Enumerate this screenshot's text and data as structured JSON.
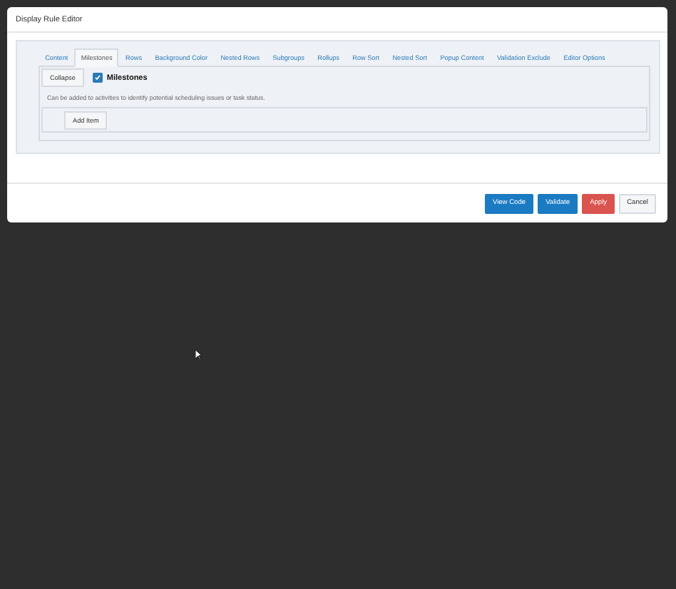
{
  "dialog": {
    "title": "Display Rule Editor"
  },
  "tabs": [
    {
      "label": "Content",
      "selected": false
    },
    {
      "label": "Milestones",
      "selected": true
    },
    {
      "label": "Rows",
      "selected": false
    },
    {
      "label": "Background Color",
      "selected": false
    },
    {
      "label": "Nested Rows",
      "selected": false
    },
    {
      "label": "Subgroups",
      "selected": false
    },
    {
      "label": "Rollups",
      "selected": false
    },
    {
      "label": "Row Sort",
      "selected": false
    },
    {
      "label": "Nested Sort",
      "selected": false
    },
    {
      "label": "Popup Content",
      "selected": false
    },
    {
      "label": "Validation Exclude",
      "selected": false
    },
    {
      "label": "Editor Options",
      "selected": false
    }
  ],
  "section": {
    "collapse_button": "Collapse",
    "checkbox": {
      "label": "Milestones",
      "checked": true
    },
    "description": "Can be added to activities to identify potential scheduling issues or task status.",
    "add_button": "Add Item"
  },
  "footer_buttons": [
    {
      "label": "View Code",
      "kind": "primary"
    },
    {
      "label": "Validate",
      "kind": "primary"
    },
    {
      "label": "Apply",
      "kind": "danger"
    },
    {
      "label": "Cancel",
      "kind": "default"
    }
  ]
}
